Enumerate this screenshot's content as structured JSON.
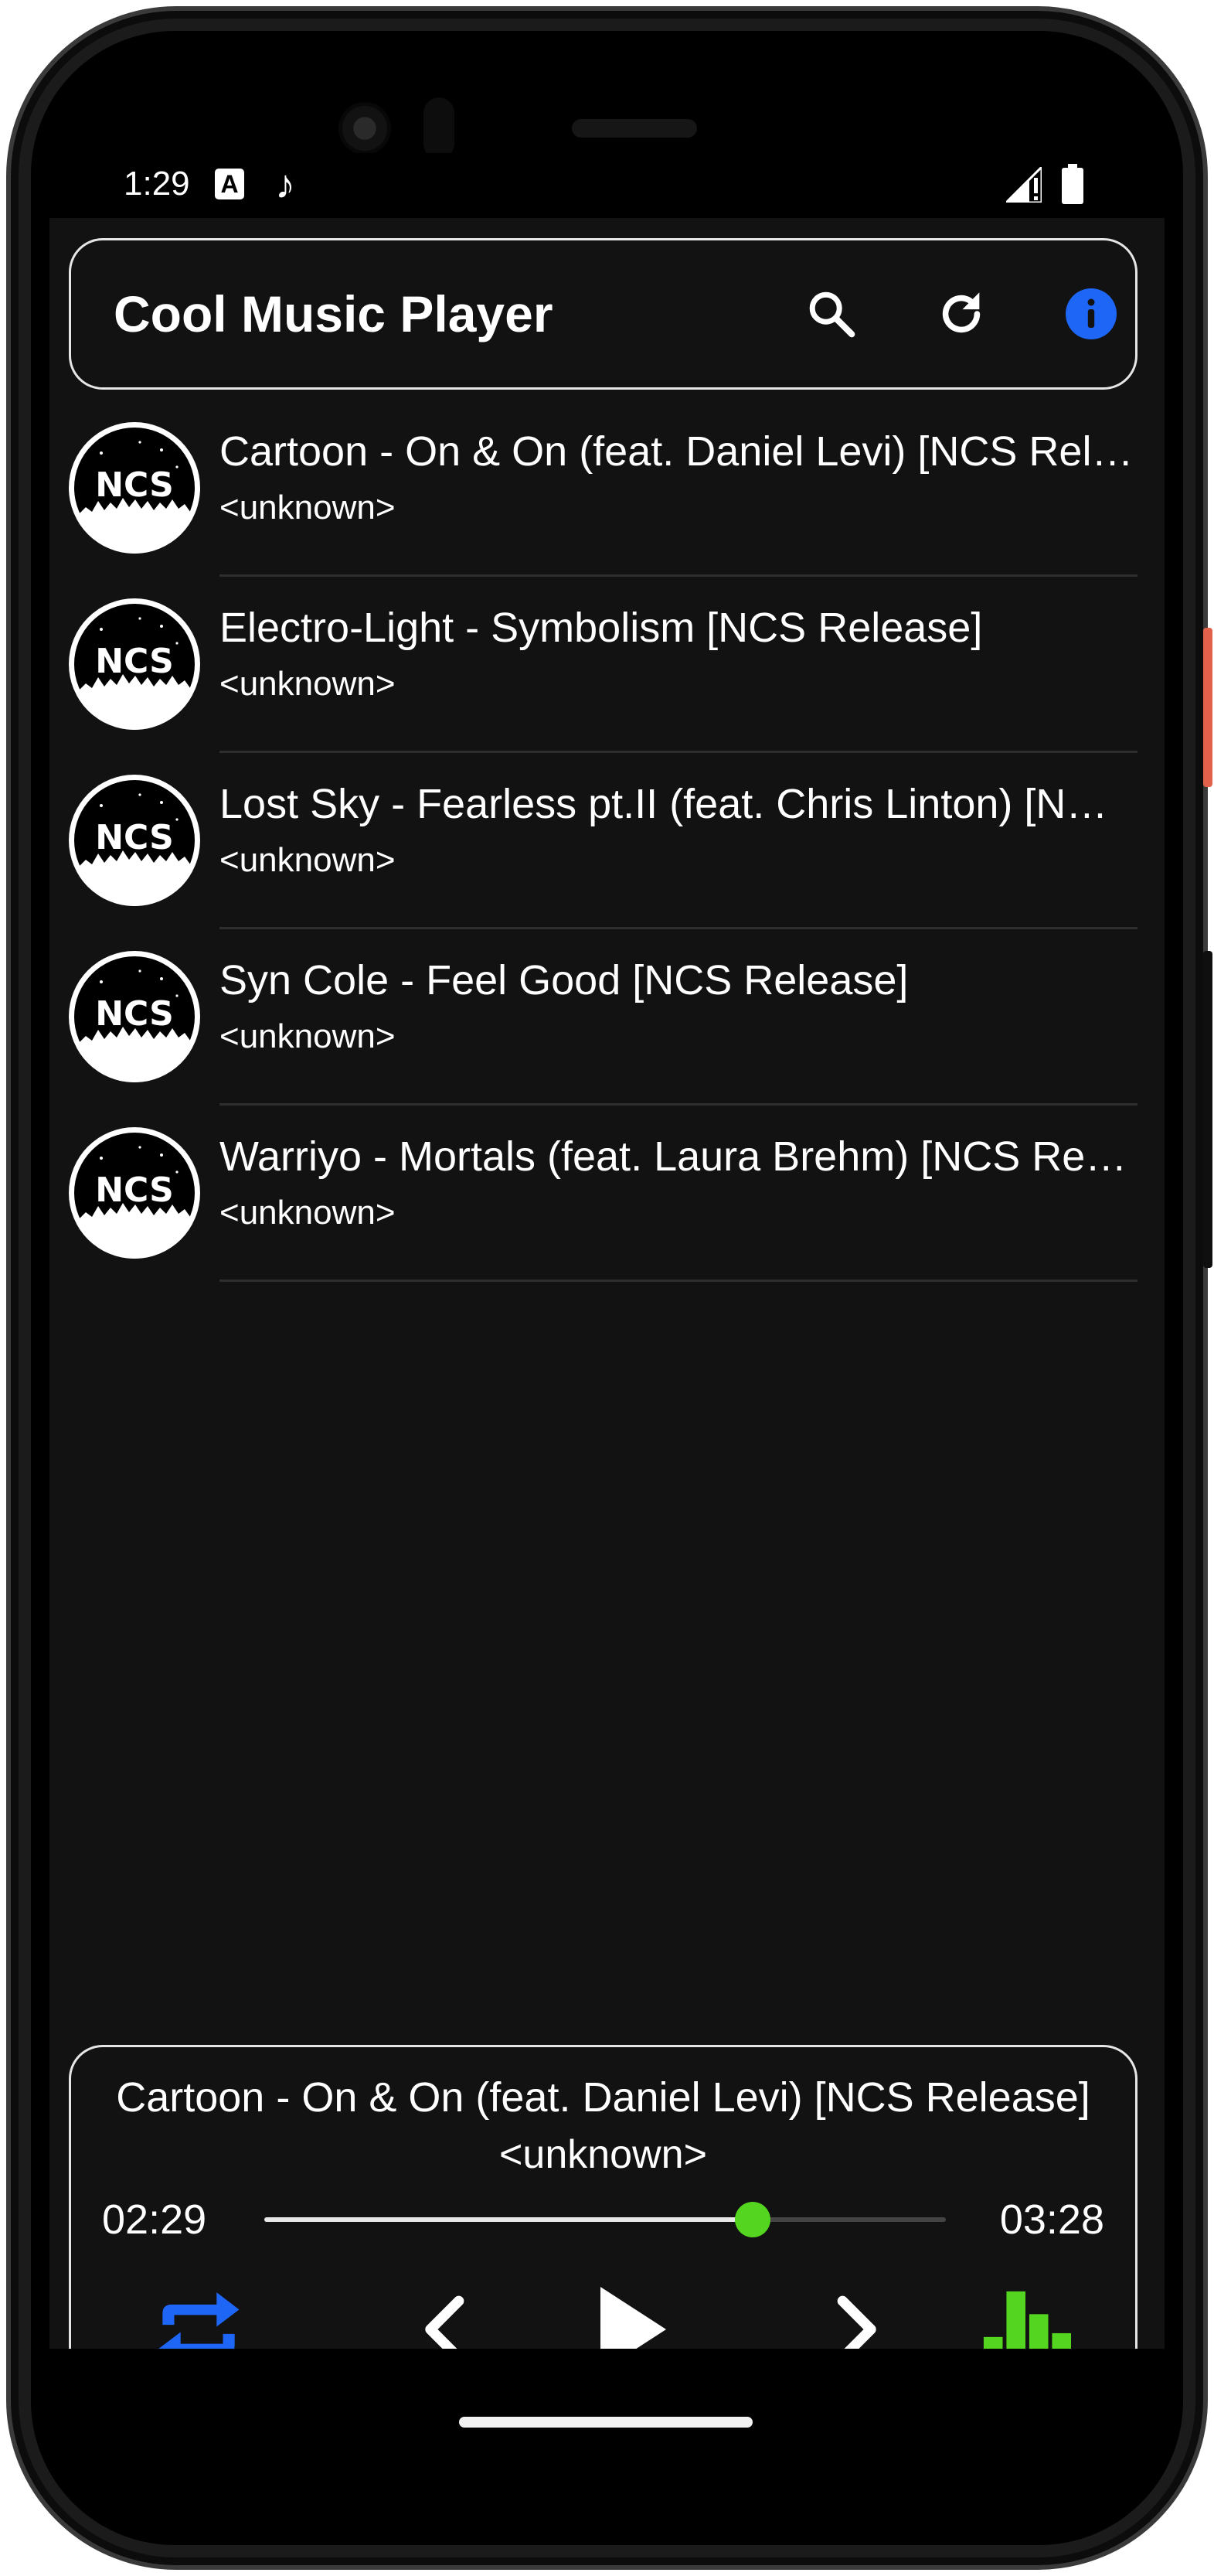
{
  "status_bar": {
    "time": "1:29",
    "a_icon_letter": "A",
    "note_icon_glyph": "♪",
    "icons": [
      "a-notification-icon",
      "music-note-icon",
      "signal-icon",
      "battery-icon"
    ]
  },
  "app_bar": {
    "title": "Cool Music Player",
    "icons": [
      "search-icon",
      "refresh-icon",
      "info-icon"
    ],
    "info_color": "#1e66f5"
  },
  "songs": [
    {
      "title": "Cartoon - On & On (feat. Daniel Levi) [NCS Release]",
      "artist": "<unknown>",
      "art_text": "NCS"
    },
    {
      "title": "Electro-Light - Symbolism [NCS Release]",
      "artist": "<unknown>",
      "art_text": "NCS"
    },
    {
      "title": "Lost Sky - Fearless pt.II (feat. Chris Linton) [NCS Release]",
      "artist": "<unknown>",
      "art_text": "NCS"
    },
    {
      "title": "Syn Cole - Feel Good [NCS Release]",
      "artist": "<unknown>",
      "art_text": "NCS"
    },
    {
      "title": "Warriyo - Mortals (feat. Laura Brehm) [NCS Release]",
      "artist": "<unknown>",
      "art_text": "NCS"
    }
  ],
  "player": {
    "title": "Cartoon - On & On (feat. Daniel Levi) [NCS Release]",
    "artist": "<unknown>",
    "elapsed": "02:29",
    "total": "03:28",
    "progress_fraction": 0.716,
    "controls": [
      "repeat-icon",
      "previous-icon",
      "play-icon",
      "next-icon",
      "equalizer-icon"
    ],
    "accent_blue": "#1e66f5",
    "accent_green": "#54d51f"
  }
}
